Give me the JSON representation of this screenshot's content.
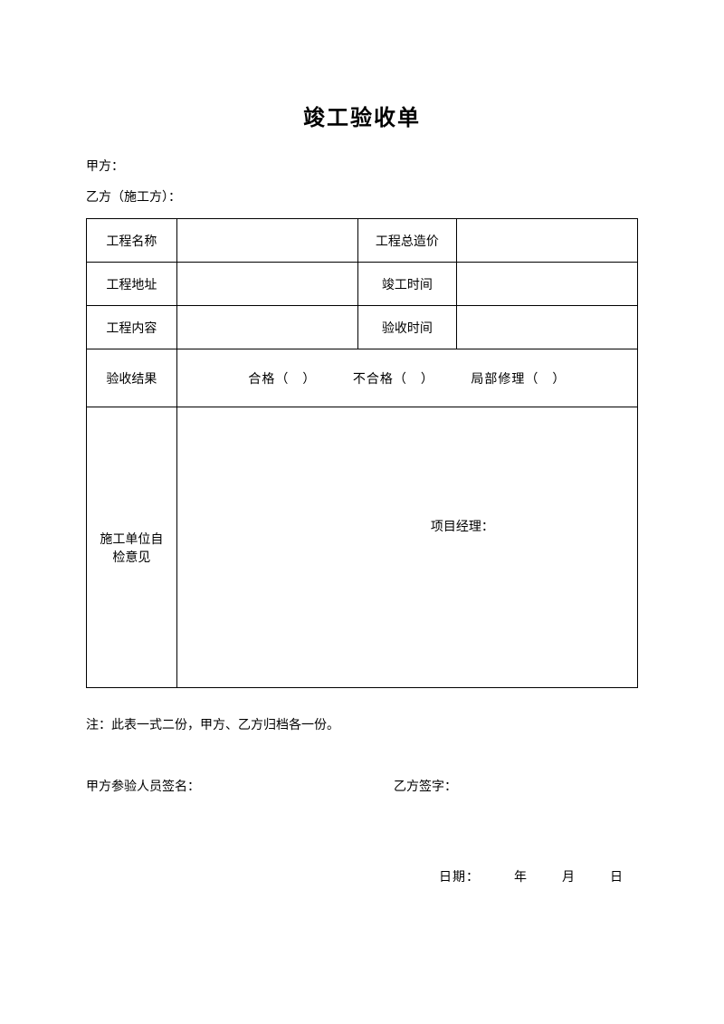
{
  "title": "竣工验收单",
  "partyA": "甲方：",
  "partyB": "乙方（施工方）：",
  "labels": {
    "projectName": "工程名称",
    "totalPrice": "工程总造价",
    "projectAddress": "工程地址",
    "completionTime": "竣工时间",
    "projectContent": "工程内容",
    "acceptanceTime": "验收时间",
    "acceptanceResult": "验收结果",
    "selfCheckOpinion": "施工单位自检意见",
    "projectManager": "项目经理："
  },
  "resultOptions": {
    "qualified": "合格（　）",
    "unqualified": "不合格（　）",
    "partialRepair": "局部修理（　）"
  },
  "note": "注：此表一式二份，甲方、乙方归档各一份。",
  "signatures": {
    "partyASign": "甲方参验人员签名：",
    "partyBSign": "乙方签字："
  },
  "date": {
    "label": "日期：",
    "year": "年",
    "month": "月",
    "day": "日"
  }
}
